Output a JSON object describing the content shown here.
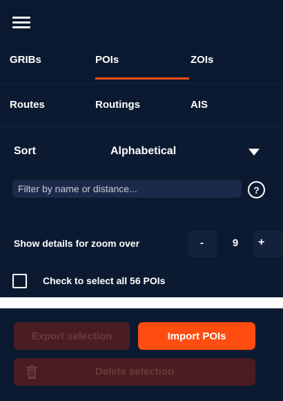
{
  "header": {
    "menu_icon": "hamburger-menu-icon",
    "tabs_row1": [
      {
        "label": "GRIBs",
        "active": false
      },
      {
        "label": "POIs",
        "active": true
      },
      {
        "label": "ZOIs",
        "active": false
      }
    ],
    "tabs_row2": [
      {
        "label": "Routes"
      },
      {
        "label": "Routings"
      },
      {
        "label": "AIS"
      }
    ]
  },
  "sort": {
    "label": "Sort",
    "value": "Alphabetical",
    "caret_icon": "caret-down-icon"
  },
  "filter": {
    "placeholder": "Filter by name or distance...",
    "value": "",
    "help_label": "?"
  },
  "zoom": {
    "label": "Show details for zoom over",
    "minus_label": "-",
    "value": "9",
    "plus_label": "+"
  },
  "select_all": {
    "label": "Check to select all 56 POIs",
    "checked": false
  },
  "actions": {
    "export_label": "Export selection",
    "import_label": "Import POIs",
    "delete_label": "Delete selection",
    "delete_icon": "trash-icon"
  },
  "colors": {
    "background": "#0c1a31",
    "accent": "#ff4d12",
    "disabled_button": "#4a1d22",
    "disabled_text": "#6e3a38"
  }
}
